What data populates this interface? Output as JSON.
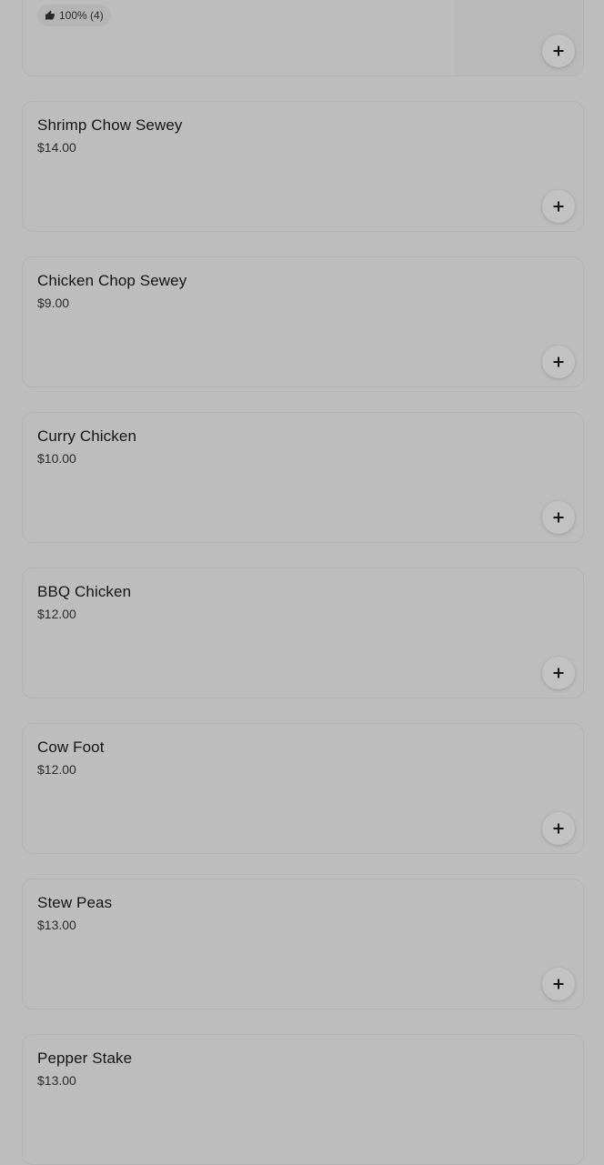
{
  "top_item": {
    "rating_text": "100% (4)"
  },
  "items": [
    {
      "name": "Shrimp Chow Sewey",
      "price": "$14.00"
    },
    {
      "name": "Chicken Chop Sewey",
      "price": "$9.00"
    },
    {
      "name": "Curry Chicken",
      "price": "$10.00"
    },
    {
      "name": "BBQ Chicken",
      "price": "$12.00"
    },
    {
      "name": "Cow Foot",
      "price": "$12.00"
    },
    {
      "name": "Stew Peas",
      "price": "$13.00"
    },
    {
      "name": "Pepper Stake",
      "price": "$13.00"
    }
  ],
  "icons": {
    "add": "plus-icon",
    "rating": "thumbs-up-icon"
  }
}
